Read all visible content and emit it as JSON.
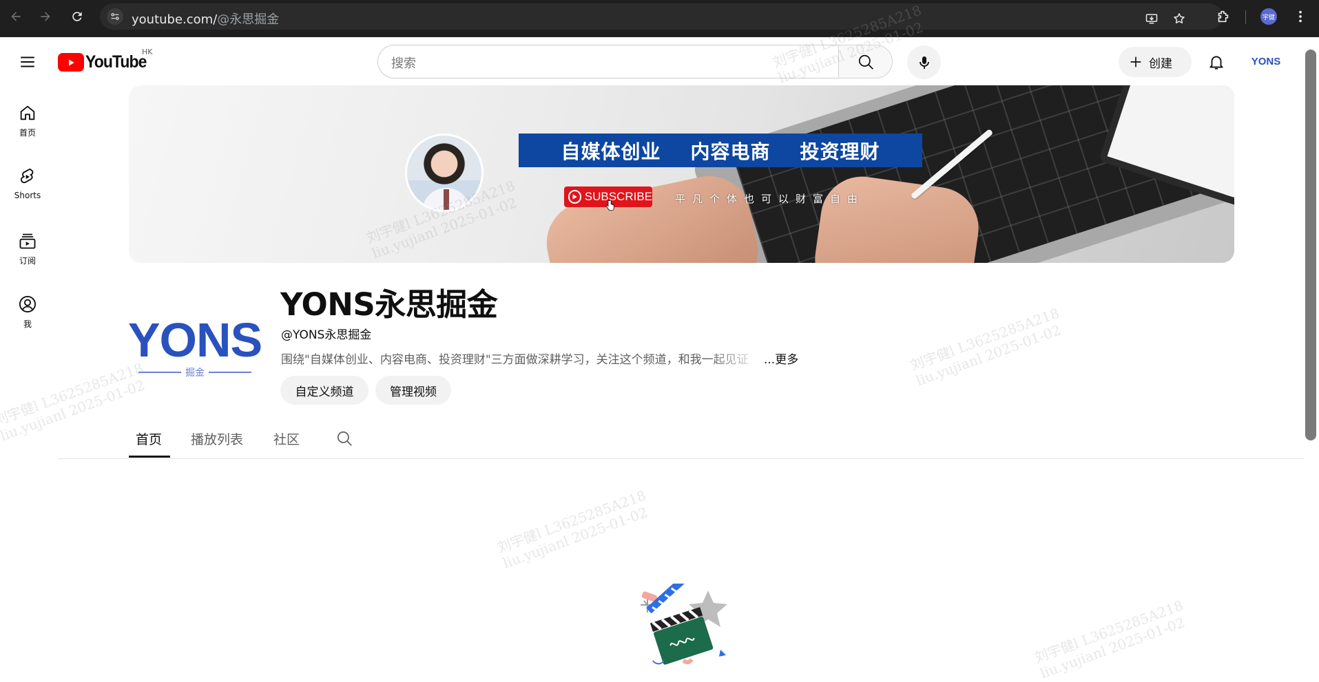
{
  "browser": {
    "url_host": "youtube.com/",
    "url_path": "@永思掘金",
    "profile_label": "宇健"
  },
  "masthead": {
    "logo_text": "YouTube",
    "region": "HK",
    "search_placeholder": "搜索",
    "create_label": "创建",
    "avatar_text": "YONS"
  },
  "guide": {
    "items": [
      {
        "label": "首页"
      },
      {
        "label": "Shorts"
      },
      {
        "label": "订阅"
      },
      {
        "label": "我"
      }
    ]
  },
  "banner": {
    "title_words": [
      "自媒体创业",
      "内容电商",
      "投资理财"
    ],
    "subscribe_label": "SUBSCRIBE",
    "slogan": "平凡个体也可以财富自由"
  },
  "channel": {
    "avatar_big": "YONS",
    "avatar_sub": "掘金",
    "name": "YONS永思掘金",
    "handle": "@YONS永思掘金",
    "description": "围绕\"自媒体创业、内容电商、投资理财\"三方面做深耕学习，关注这个频道，和我一起见证",
    "more_label": "...更多",
    "buttons": [
      "自定义频道",
      "管理视频"
    ]
  },
  "tabs": [
    {
      "label": "首页",
      "active": true
    },
    {
      "label": "播放列表",
      "active": false
    },
    {
      "label": "社区",
      "active": false
    }
  ],
  "watermark": {
    "line1": "刘宇健l L3625285A218",
    "line2": "liu.yujianl 2025-01-02"
  },
  "colors": {
    "youtube_red": "#ff0000",
    "banner_blue": "#0d47a1",
    "channel_blue": "#2a52be",
    "subscribe_red": "#e0141b"
  }
}
